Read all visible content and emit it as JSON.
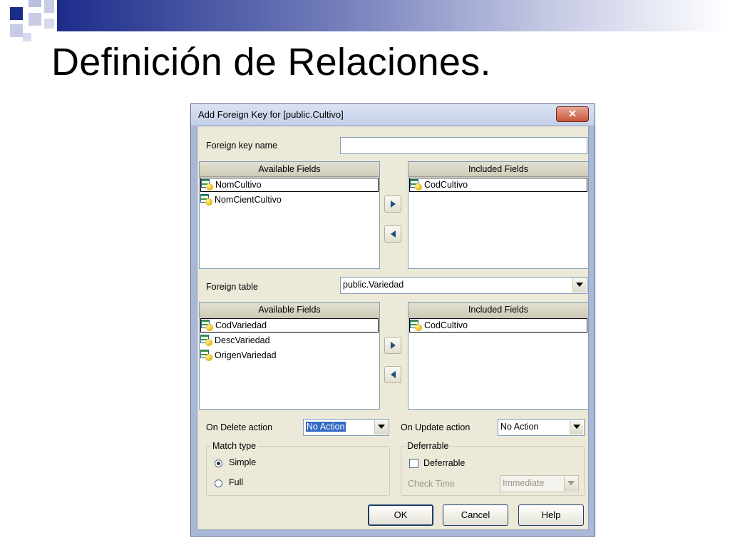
{
  "slide": {
    "title": "Definición de Relaciones."
  },
  "dialog": {
    "title": "Add Foreign Key for [public.Cultivo]",
    "close_label": "✕",
    "foreign_key_name": {
      "label": "Foreign key name",
      "value": ""
    },
    "source": {
      "available": {
        "header": "Available Fields",
        "items": [
          "NomCultivo",
          "NomCientCultivo"
        ]
      },
      "included": {
        "header": "Included Fields",
        "items": [
          "CodCultivo"
        ]
      }
    },
    "foreign_table": {
      "label": "Foreign table",
      "value": "public.Variedad"
    },
    "target": {
      "available": {
        "header": "Available Fields",
        "items": [
          "CodVariedad",
          "DescVariedad",
          "OrigenVariedad"
        ]
      },
      "included": {
        "header": "Included Fields",
        "items": [
          "CodCultivo"
        ]
      }
    },
    "on_delete": {
      "label": "On Delete action",
      "value": "No Action"
    },
    "on_update": {
      "label": "On Update action",
      "value": "No Action"
    },
    "match_type": {
      "title": "Match type",
      "options": [
        "Simple",
        "Full"
      ],
      "selected": "Simple"
    },
    "deferrable": {
      "title": "Deferrable",
      "checkbox_label": "Deferrable",
      "checked": false,
      "check_time_label": "Check Time",
      "check_time_value": "Immediate"
    },
    "buttons": {
      "ok": "OK",
      "cancel": "Cancel",
      "help": "Help"
    },
    "icons": {
      "move_right": "arrow-right-icon",
      "move_left": "arrow-left-icon",
      "field": "field-key-icon"
    }
  },
  "colors": {
    "slide_bar_dark": "#1c2c8a",
    "dialog_frame": "#aab8d8",
    "dialog_body": "#ece9d8",
    "selection": "#316ac5"
  }
}
